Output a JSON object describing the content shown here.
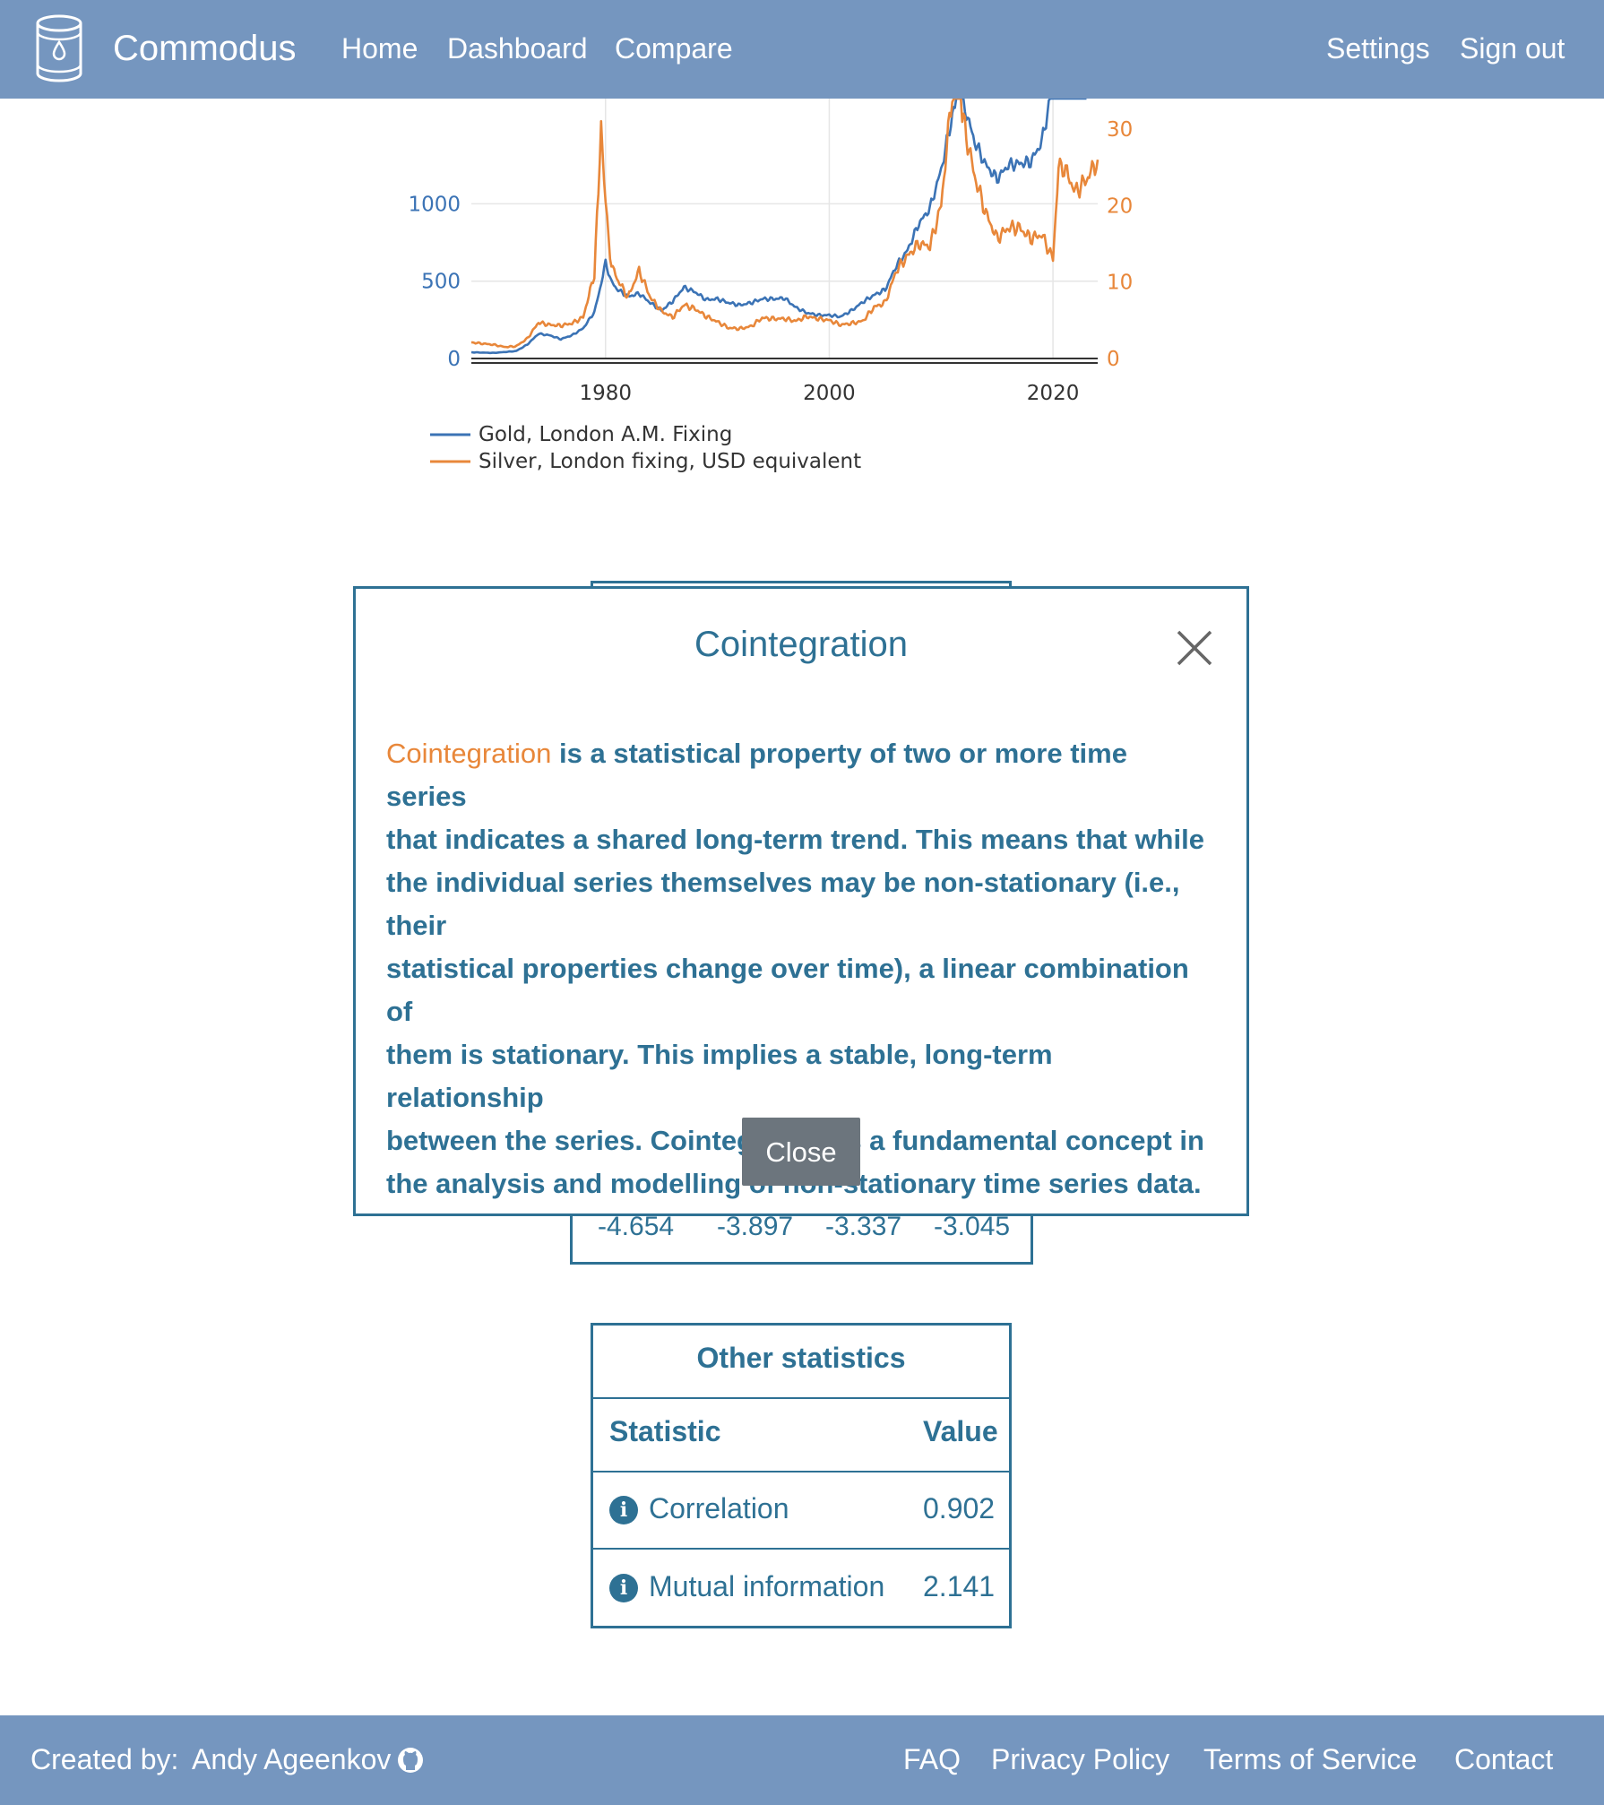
{
  "navbar": {
    "brand": "Commodus",
    "links": [
      "Home",
      "Dashboard",
      "Compare"
    ],
    "right_links": [
      "Settings",
      "Sign out"
    ],
    "logo_icon": "barrel-drop-icon"
  },
  "chart_data": {
    "type": "line",
    "x_ticks": [
      "1980",
      "2000",
      "2020"
    ],
    "y_left_ticks": [
      "0",
      "500",
      "1000"
    ],
    "y_right_ticks": [
      "0",
      "10",
      "20",
      "30"
    ],
    "series": [
      {
        "name": "Gold, London A.M. Fixing",
        "color": "#3b73b5",
        "axis": "left",
        "x": [
          1968,
          1970,
          1972,
          1973,
          1974,
          1975,
          1976,
          1977,
          1978,
          1979,
          1979.5,
          1980,
          1980.5,
          1981,
          1982,
          1983,
          1984,
          1985,
          1986,
          1987,
          1988,
          1989,
          1990,
          1991,
          1992,
          1993,
          1994,
          1995,
          1996,
          1997,
          1998,
          1999,
          2000,
          2001,
          2002,
          2003,
          2004,
          2005,
          2006,
          2007,
          2008,
          2009,
          2010,
          2011,
          2011.7,
          2012,
          2013,
          2014,
          2015,
          2016,
          2017,
          2018,
          2019,
          2020,
          2021,
          2022,
          2023
        ],
        "y": [
          40,
          36,
          48,
          90,
          160,
          150,
          125,
          150,
          195,
          300,
          450,
          620,
          500,
          450,
          400,
          420,
          360,
          310,
          370,
          460,
          430,
          380,
          385,
          360,
          345,
          360,
          385,
          385,
          390,
          330,
          295,
          280,
          280,
          270,
          310,
          365,
          410,
          445,
          600,
          700,
          870,
          970,
          1220,
          1570,
          1800,
          1650,
          1400,
          1250,
          1160,
          1250,
          1260,
          1270,
          1400,
          1770,
          1800,
          1800,
          1940
        ]
      },
      {
        "name": "Silver, London fixing, USD equivalent",
        "color": "#e8873a",
        "axis": "right",
        "x": [
          1968,
          1970,
          1971,
          1972,
          1973,
          1974,
          1975,
          1976,
          1977,
          1978,
          1979,
          1979.6,
          1980,
          1980.4,
          1981,
          1982,
          1983,
          1984,
          1985,
          1986,
          1987,
          1988,
          1989,
          1990,
          1991,
          1992,
          1993,
          1994,
          1995,
          1996,
          1997,
          1998,
          1999,
          2000,
          2001,
          2002,
          2003,
          2004,
          2005,
          2006,
          2007,
          2008,
          2009,
          2010,
          2011,
          2011.3,
          2012,
          2013,
          2014,
          2015,
          2016,
          2017,
          2018,
          2019,
          2020,
          2020.5,
          2021,
          2022,
          2023,
          2024
        ],
        "y": [
          2.1,
          1.8,
          1.5,
          1.6,
          2.6,
          4.7,
          4.4,
          4.3,
          4.6,
          5.4,
          11,
          30,
          20,
          13,
          10.5,
          8,
          11.5,
          8,
          6.2,
          5.4,
          7,
          6.5,
          5.5,
          4.8,
          4,
          3.9,
          4.2,
          5.3,
          5.2,
          5.2,
          4.9,
          5.5,
          5.2,
          5,
          4.4,
          4.6,
          4.9,
          6.7,
          7.3,
          11.5,
          13.4,
          15,
          14.7,
          20,
          35,
          40,
          31,
          23.8,
          19,
          15.7,
          17.1,
          17.1,
          15.7,
          16.2,
          13,
          25,
          25,
          21.8,
          23.4,
          26
        ]
      }
    ],
    "legend": "bottom"
  },
  "critical_values": [
    "-4.654",
    "-3.897",
    "-3.337",
    "-3.045"
  ],
  "stats": {
    "title": "Other statistics",
    "header_statistic": "Statistic",
    "header_value": "Value",
    "rows": [
      {
        "label": "Correlation",
        "value": "0.902"
      },
      {
        "label": "Mutual information",
        "value": "2.141"
      }
    ]
  },
  "modal": {
    "title": "Cointegration",
    "term": "Cointegration",
    "lines": [
      " is a statistical property of two or more time series",
      "that indicates a shared long-term trend. This means that while",
      "the individual series themselves may be non-stationary (i.e., their",
      "statistical properties change over time), a linear combination of",
      "them is stationary. This implies a stable, long-term relationship",
      "between the series. Cointegration is a fundamental concept in",
      "the analysis and modelling of non-stationary time series data."
    ],
    "close_label": "Close"
  },
  "footer": {
    "created_by": "Created by:",
    "author": "Andy Ageenkov",
    "links": [
      "FAQ",
      "Privacy Policy",
      "Terms of Service",
      "Contact"
    ]
  }
}
